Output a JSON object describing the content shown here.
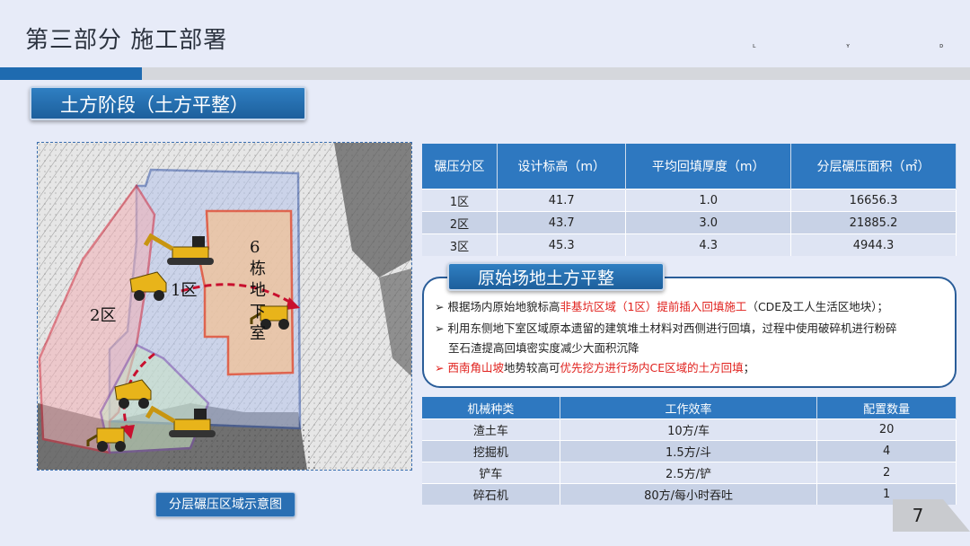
{
  "header": {
    "title": "第三部分  施工部署",
    "marks": [
      "ʟ",
      "ʏ",
      "ᴅ"
    ]
  },
  "section": {
    "label": "土方阶段（土方平整）"
  },
  "map": {
    "labels": {
      "zone1": "1区",
      "zone2": "2区",
      "building_number": "6",
      "building_char1": "栋",
      "building_char2": "地",
      "building_char3": "下",
      "building_char4": "室"
    },
    "caption": "分层碾压区域示意图",
    "colors": {
      "zone1_border": "#2f52a8",
      "zone2_border": "#d6283a",
      "building_border": "#e54a2a",
      "zone3_border": "#7a4fa8",
      "arrow": "#c8102e"
    }
  },
  "compaction_table": {
    "headers": [
      "碾压分区",
      "设计标高（m）",
      "平均回填厚度（m）",
      "分层碾压面积（㎡）"
    ],
    "rows": [
      [
        "1区",
        "41.7",
        "1.0",
        "16656.3"
      ],
      [
        "2区",
        "43.7",
        "3.0",
        "21885.2"
      ],
      [
        "3区",
        "45.3",
        "4.3",
        "4944.3"
      ]
    ]
  },
  "notes": {
    "title": "原始场地土方平整",
    "b1_a": "根据场内原始地貌标高",
    "b1_b": "非基坑区域（1区）提前插入回填施工",
    "b1_c": "（CDE及工人生活区地块）；",
    "b2_l1": "利用东侧地下室区域原本遗留的建筑堆土材料对西侧进行回填，过程中使用破碎机进行粉碎",
    "b2_l2": "至石渣提高回填密实度减少大面积沉降",
    "b3_a": "西南角山坡",
    "b3_b": "地势较高可",
    "b3_c": "优先挖方进行场内CE区域的土方回填",
    "b3_d": "；"
  },
  "machine_table": {
    "headers": [
      "机械种类",
      "工作效率",
      "配置数量"
    ],
    "rows": [
      [
        "渣土车",
        "10方/车",
        "20"
      ],
      [
        "挖掘机",
        "1.5方/斗",
        "4"
      ],
      [
        "铲车",
        "2.5方/铲",
        "2"
      ],
      [
        "碎石机",
        "80方/每小时吞吐",
        "1"
      ]
    ]
  },
  "page": {
    "number": "7"
  }
}
